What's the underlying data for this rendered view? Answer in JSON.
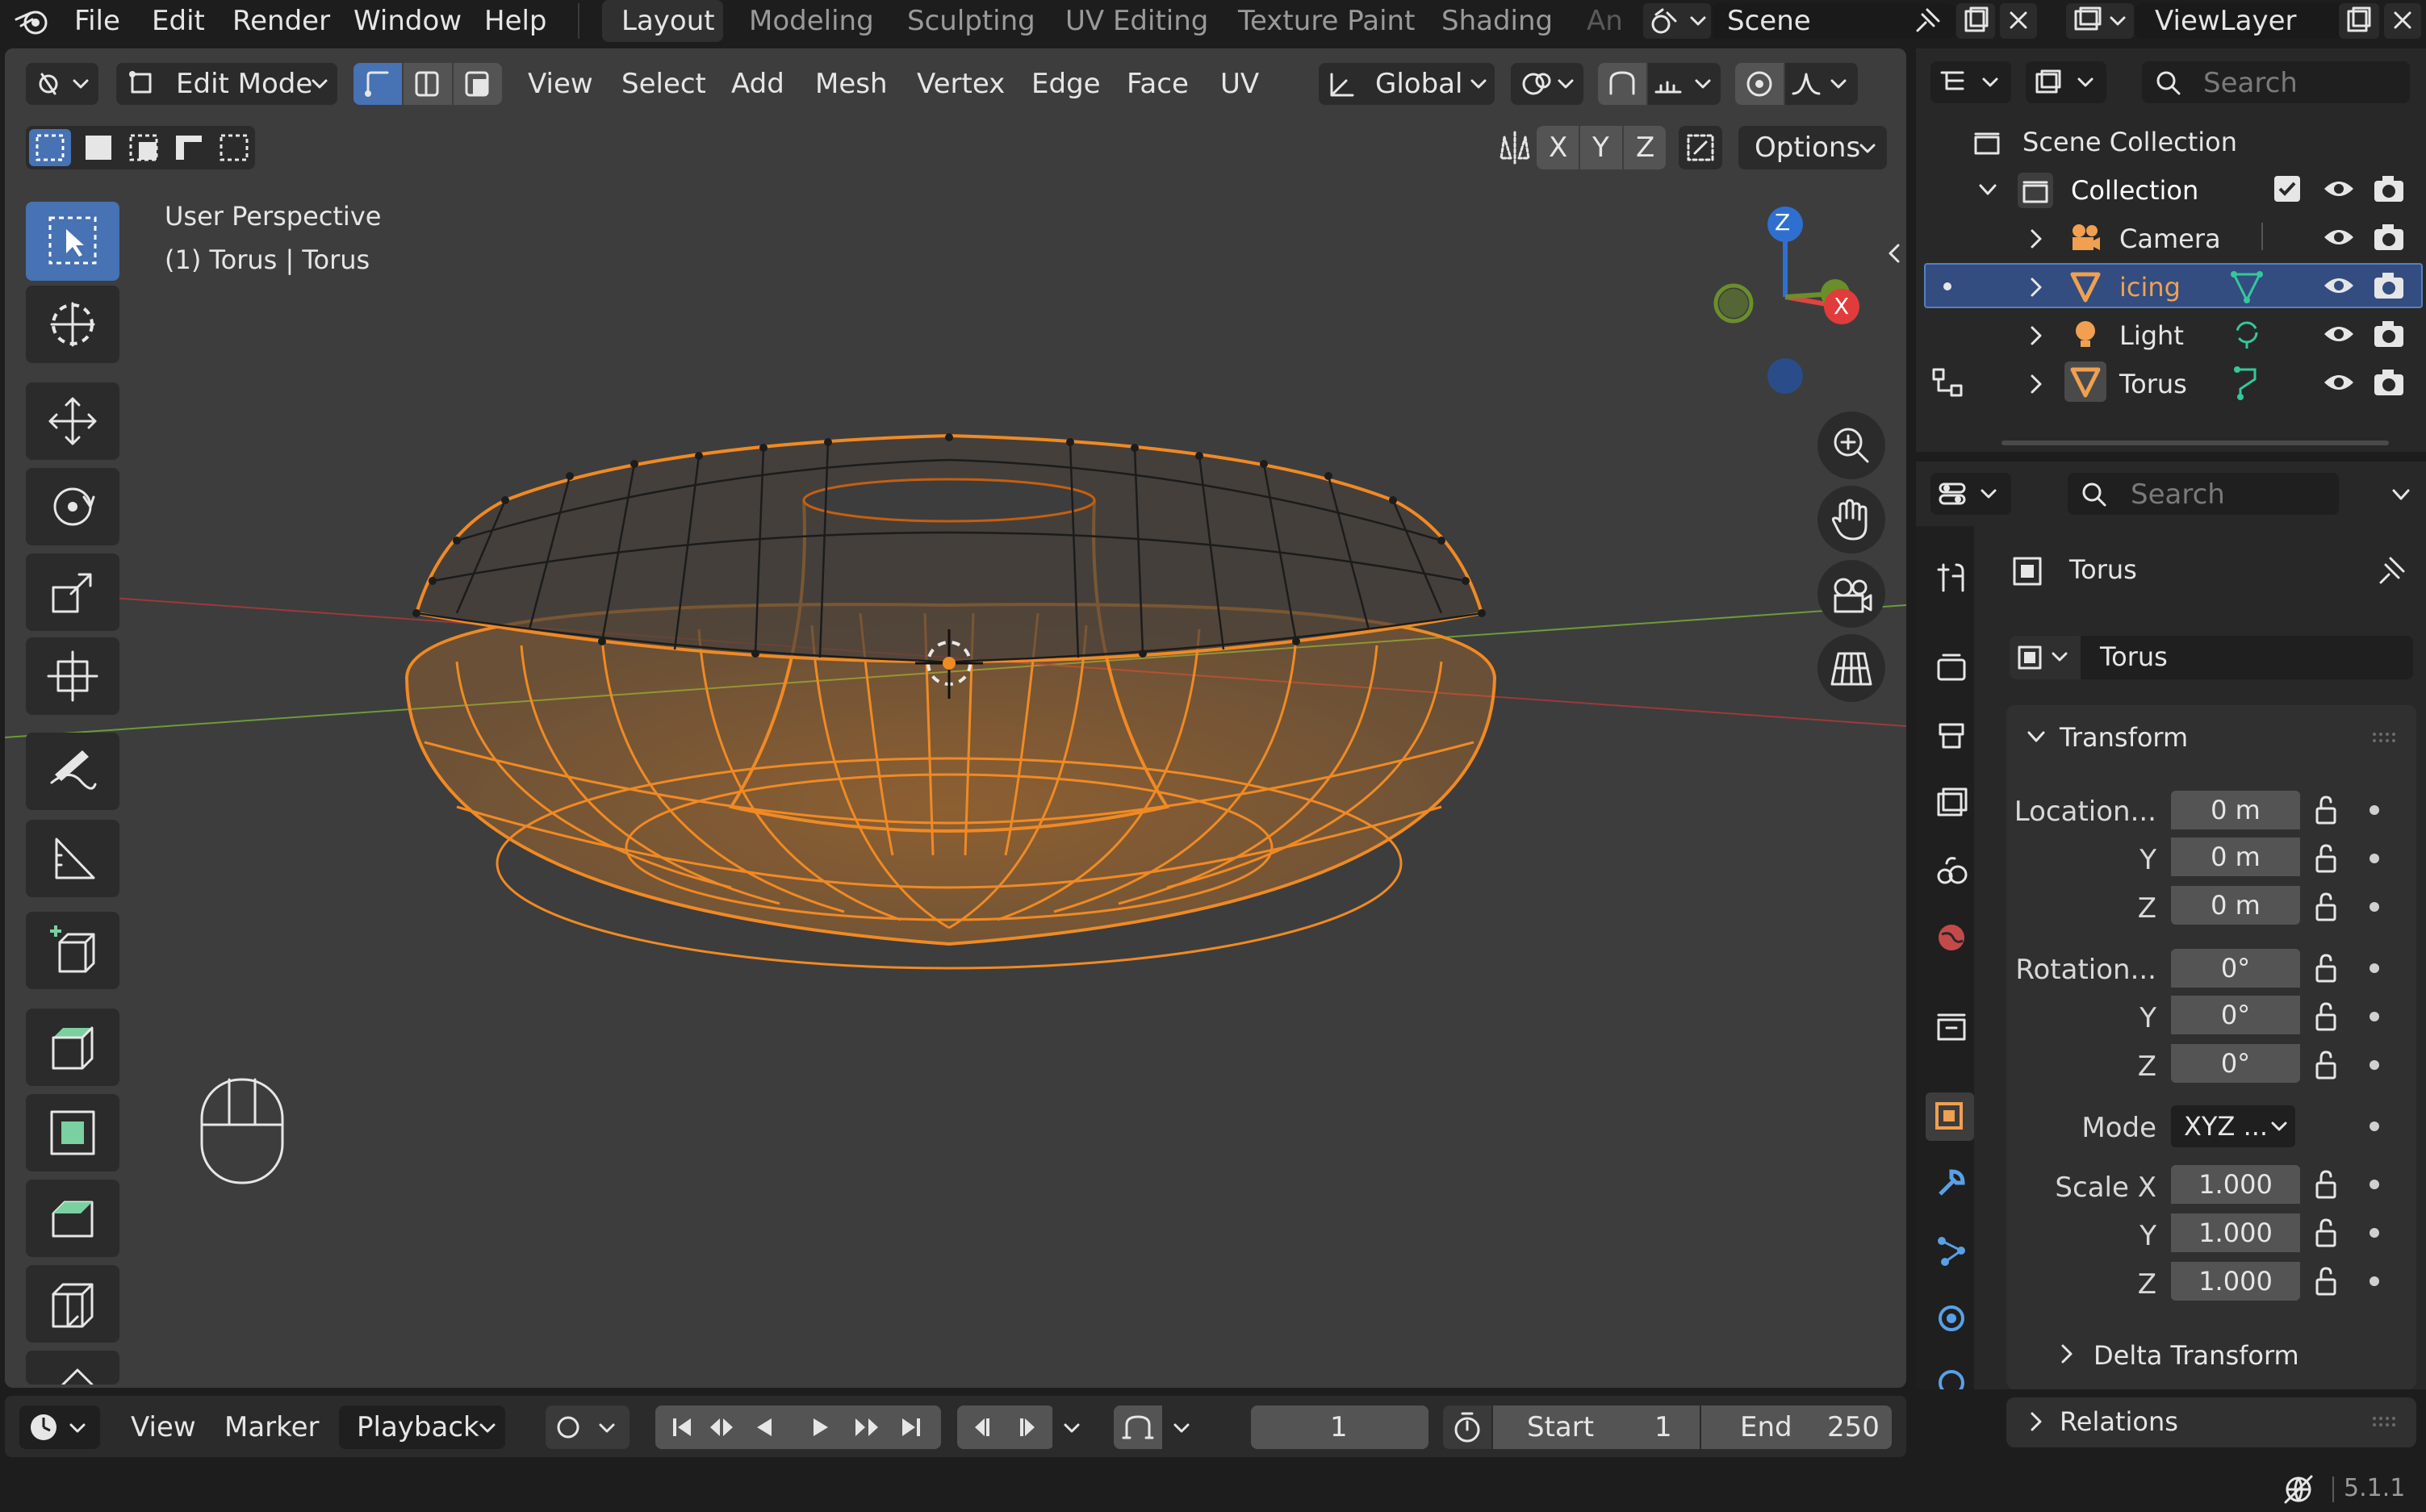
{
  "topbar": {
    "menus": [
      "File",
      "Edit",
      "Render",
      "Window",
      "Help"
    ],
    "workspaces": [
      "Layout",
      "Modeling",
      "Sculpting",
      "UV Editing",
      "Texture Paint",
      "Shading",
      "An"
    ],
    "scene": "Scene",
    "view_layer": "ViewLayer"
  },
  "header": {
    "mode": "Edit Mode",
    "menus": [
      "View",
      "Select",
      "Add",
      "Mesh",
      "Vertex",
      "Edge",
      "Face",
      "UV"
    ],
    "orientation": "Global",
    "axes": [
      "X",
      "Y",
      "Z"
    ],
    "options": "Options"
  },
  "viewport": {
    "overlay_line1": "User Perspective",
    "overlay_line2": "(1) Torus | Torus",
    "gizmo": {
      "z": "Z",
      "x": "X"
    },
    "accent": "#f08a24"
  },
  "outliner": {
    "search_placeholder": "Search",
    "root": "Scene Collection",
    "collection": "Collection",
    "items": [
      {
        "name": "Camera",
        "icon": "camera-icon",
        "selected": false
      },
      {
        "name": "icing",
        "icon": "mesh-icon",
        "selected": true
      },
      {
        "name": "Light",
        "icon": "light-icon",
        "selected": false
      },
      {
        "name": "Torus",
        "icon": "mesh-icon",
        "selected": false
      }
    ]
  },
  "properties": {
    "search_placeholder": "Search",
    "object_name": "Torus",
    "datablock": "Torus",
    "transform_panel": "Transform",
    "location_label": "Location...",
    "rotation_label": "Rotation...",
    "scale_label": "Scale X",
    "y_label": "Y",
    "z_label": "Z",
    "location": [
      "0 m",
      "0 m",
      "0 m"
    ],
    "rotation": [
      "0°",
      "0°",
      "0°"
    ],
    "mode_label": "Mode",
    "mode_value": "XYZ ...",
    "scale": [
      "1.000",
      "1.000",
      "1.000"
    ],
    "delta_transform": "Delta Transform",
    "relations": "Relations"
  },
  "timeline": {
    "menus": [
      "View",
      "Marker"
    ],
    "playback": "Playback",
    "current_frame": "1",
    "start_label": "Start",
    "start_value": "1",
    "end_label": "End",
    "end_value": "250"
  },
  "status": {
    "version": "5.1.1"
  }
}
